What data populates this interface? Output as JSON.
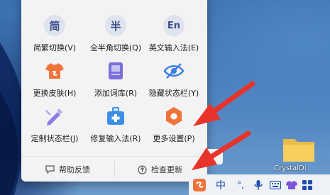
{
  "desktop": {
    "folder_label": "CrystalDi"
  },
  "ime_menu": {
    "items": [
      {
        "label": "简繁切换(V)",
        "glyph": "简",
        "icon": "simplified-traditional-icon"
      },
      {
        "label": "全半角切换(Q)",
        "glyph": "半",
        "icon": "half-width-icon"
      },
      {
        "label": "英文输入法(E)",
        "glyph": "En",
        "icon": "english-input-icon"
      },
      {
        "label": "更换皮肤(H)",
        "icon": "shirt-icon"
      },
      {
        "label": "添加词库(R)",
        "icon": "dictionary-icon"
      },
      {
        "label": "隐藏状态栏(Y)",
        "icon": "eye-hidden-icon"
      },
      {
        "label": "定制状态栏(J)",
        "icon": "customize-icon"
      },
      {
        "label": "修复输入法(R)",
        "icon": "repair-kit-icon"
      },
      {
        "label": "更多设置(P)",
        "icon": "settings-hex-icon"
      }
    ],
    "footer": {
      "help_label": "帮助反馈",
      "update_label": "检查更新"
    },
    "side_stub": "j"
  },
  "taskbar": {
    "ime_mode": "中",
    "punct": "°,",
    "tray_icons": [
      "sogou-logo-icon",
      "microphone-icon",
      "keyboard-icon",
      "shirt-tray-icon",
      "grid-menu-icon"
    ]
  },
  "colors": {
    "accent_blue": "#3c4f8c",
    "orange": "#f0743a",
    "arrow_red": "#e8332a"
  }
}
